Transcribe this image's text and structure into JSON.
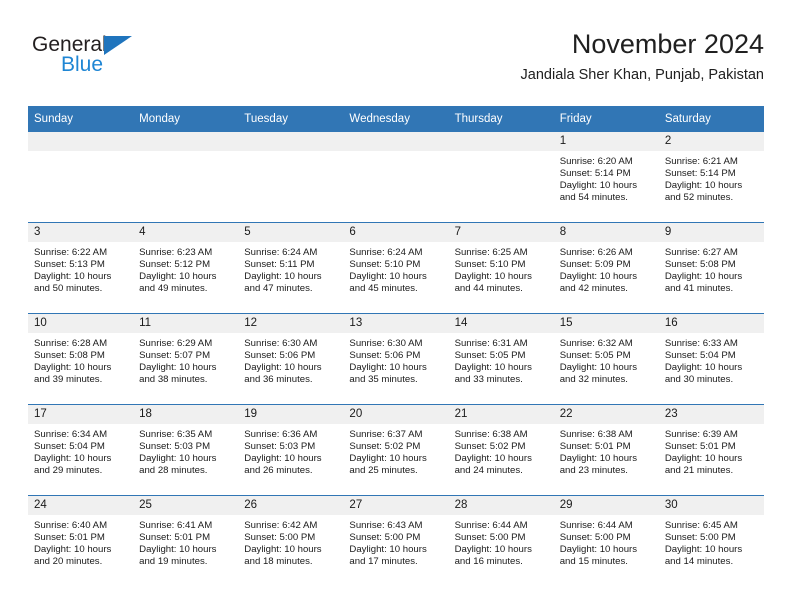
{
  "logo": {
    "word_one": "General",
    "word_two": "Blue",
    "triangle_icon": "triangle-icon",
    "accent_dark": "#231f20",
    "accent_blue": "#1f86d4"
  },
  "header": {
    "month_title": "November 2024",
    "location": "Jandiala Sher Khan, Punjab, Pakistan"
  },
  "theme": {
    "header_blue": "#3176b5",
    "daynum_gray": "#f0f0f0",
    "text": "#1a1a1a"
  },
  "weekday_headers": [
    "Sunday",
    "Monday",
    "Tuesday",
    "Wednesday",
    "Thursday",
    "Friday",
    "Saturday"
  ],
  "weeks": [
    [
      {
        "day": "",
        "sunrise": "",
        "sunset": "",
        "daylight_1": "",
        "daylight_2": ""
      },
      {
        "day": "",
        "sunrise": "",
        "sunset": "",
        "daylight_1": "",
        "daylight_2": ""
      },
      {
        "day": "",
        "sunrise": "",
        "sunset": "",
        "daylight_1": "",
        "daylight_2": ""
      },
      {
        "day": "",
        "sunrise": "",
        "sunset": "",
        "daylight_1": "",
        "daylight_2": ""
      },
      {
        "day": "",
        "sunrise": "",
        "sunset": "",
        "daylight_1": "",
        "daylight_2": ""
      },
      {
        "day": "1",
        "sunrise": "Sunrise: 6:20 AM",
        "sunset": "Sunset: 5:14 PM",
        "daylight_1": "Daylight: 10 hours",
        "daylight_2": "and 54 minutes."
      },
      {
        "day": "2",
        "sunrise": "Sunrise: 6:21 AM",
        "sunset": "Sunset: 5:14 PM",
        "daylight_1": "Daylight: 10 hours",
        "daylight_2": "and 52 minutes."
      }
    ],
    [
      {
        "day": "3",
        "sunrise": "Sunrise: 6:22 AM",
        "sunset": "Sunset: 5:13 PM",
        "daylight_1": "Daylight: 10 hours",
        "daylight_2": "and 50 minutes."
      },
      {
        "day": "4",
        "sunrise": "Sunrise: 6:23 AM",
        "sunset": "Sunset: 5:12 PM",
        "daylight_1": "Daylight: 10 hours",
        "daylight_2": "and 49 minutes."
      },
      {
        "day": "5",
        "sunrise": "Sunrise: 6:24 AM",
        "sunset": "Sunset: 5:11 PM",
        "daylight_1": "Daylight: 10 hours",
        "daylight_2": "and 47 minutes."
      },
      {
        "day": "6",
        "sunrise": "Sunrise: 6:24 AM",
        "sunset": "Sunset: 5:10 PM",
        "daylight_1": "Daylight: 10 hours",
        "daylight_2": "and 45 minutes."
      },
      {
        "day": "7",
        "sunrise": "Sunrise: 6:25 AM",
        "sunset": "Sunset: 5:10 PM",
        "daylight_1": "Daylight: 10 hours",
        "daylight_2": "and 44 minutes."
      },
      {
        "day": "8",
        "sunrise": "Sunrise: 6:26 AM",
        "sunset": "Sunset: 5:09 PM",
        "daylight_1": "Daylight: 10 hours",
        "daylight_2": "and 42 minutes."
      },
      {
        "day": "9",
        "sunrise": "Sunrise: 6:27 AM",
        "sunset": "Sunset: 5:08 PM",
        "daylight_1": "Daylight: 10 hours",
        "daylight_2": "and 41 minutes."
      }
    ],
    [
      {
        "day": "10",
        "sunrise": "Sunrise: 6:28 AM",
        "sunset": "Sunset: 5:08 PM",
        "daylight_1": "Daylight: 10 hours",
        "daylight_2": "and 39 minutes."
      },
      {
        "day": "11",
        "sunrise": "Sunrise: 6:29 AM",
        "sunset": "Sunset: 5:07 PM",
        "daylight_1": "Daylight: 10 hours",
        "daylight_2": "and 38 minutes."
      },
      {
        "day": "12",
        "sunrise": "Sunrise: 6:30 AM",
        "sunset": "Sunset: 5:06 PM",
        "daylight_1": "Daylight: 10 hours",
        "daylight_2": "and 36 minutes."
      },
      {
        "day": "13",
        "sunrise": "Sunrise: 6:30 AM",
        "sunset": "Sunset: 5:06 PM",
        "daylight_1": "Daylight: 10 hours",
        "daylight_2": "and 35 minutes."
      },
      {
        "day": "14",
        "sunrise": "Sunrise: 6:31 AM",
        "sunset": "Sunset: 5:05 PM",
        "daylight_1": "Daylight: 10 hours",
        "daylight_2": "and 33 minutes."
      },
      {
        "day": "15",
        "sunrise": "Sunrise: 6:32 AM",
        "sunset": "Sunset: 5:05 PM",
        "daylight_1": "Daylight: 10 hours",
        "daylight_2": "and 32 minutes."
      },
      {
        "day": "16",
        "sunrise": "Sunrise: 6:33 AM",
        "sunset": "Sunset: 5:04 PM",
        "daylight_1": "Daylight: 10 hours",
        "daylight_2": "and 30 minutes."
      }
    ],
    [
      {
        "day": "17",
        "sunrise": "Sunrise: 6:34 AM",
        "sunset": "Sunset: 5:04 PM",
        "daylight_1": "Daylight: 10 hours",
        "daylight_2": "and 29 minutes."
      },
      {
        "day": "18",
        "sunrise": "Sunrise: 6:35 AM",
        "sunset": "Sunset: 5:03 PM",
        "daylight_1": "Daylight: 10 hours",
        "daylight_2": "and 28 minutes."
      },
      {
        "day": "19",
        "sunrise": "Sunrise: 6:36 AM",
        "sunset": "Sunset: 5:03 PM",
        "daylight_1": "Daylight: 10 hours",
        "daylight_2": "and 26 minutes."
      },
      {
        "day": "20",
        "sunrise": "Sunrise: 6:37 AM",
        "sunset": "Sunset: 5:02 PM",
        "daylight_1": "Daylight: 10 hours",
        "daylight_2": "and 25 minutes."
      },
      {
        "day": "21",
        "sunrise": "Sunrise: 6:38 AM",
        "sunset": "Sunset: 5:02 PM",
        "daylight_1": "Daylight: 10 hours",
        "daylight_2": "and 24 minutes."
      },
      {
        "day": "22",
        "sunrise": "Sunrise: 6:38 AM",
        "sunset": "Sunset: 5:01 PM",
        "daylight_1": "Daylight: 10 hours",
        "daylight_2": "and 23 minutes."
      },
      {
        "day": "23",
        "sunrise": "Sunrise: 6:39 AM",
        "sunset": "Sunset: 5:01 PM",
        "daylight_1": "Daylight: 10 hours",
        "daylight_2": "and 21 minutes."
      }
    ],
    [
      {
        "day": "24",
        "sunrise": "Sunrise: 6:40 AM",
        "sunset": "Sunset: 5:01 PM",
        "daylight_1": "Daylight: 10 hours",
        "daylight_2": "and 20 minutes."
      },
      {
        "day": "25",
        "sunrise": "Sunrise: 6:41 AM",
        "sunset": "Sunset: 5:01 PM",
        "daylight_1": "Daylight: 10 hours",
        "daylight_2": "and 19 minutes."
      },
      {
        "day": "26",
        "sunrise": "Sunrise: 6:42 AM",
        "sunset": "Sunset: 5:00 PM",
        "daylight_1": "Daylight: 10 hours",
        "daylight_2": "and 18 minutes."
      },
      {
        "day": "27",
        "sunrise": "Sunrise: 6:43 AM",
        "sunset": "Sunset: 5:00 PM",
        "daylight_1": "Daylight: 10 hours",
        "daylight_2": "and 17 minutes."
      },
      {
        "day": "28",
        "sunrise": "Sunrise: 6:44 AM",
        "sunset": "Sunset: 5:00 PM",
        "daylight_1": "Daylight: 10 hours",
        "daylight_2": "and 16 minutes."
      },
      {
        "day": "29",
        "sunrise": "Sunrise: 6:44 AM",
        "sunset": "Sunset: 5:00 PM",
        "daylight_1": "Daylight: 10 hours",
        "daylight_2": "and 15 minutes."
      },
      {
        "day": "30",
        "sunrise": "Sunrise: 6:45 AM",
        "sunset": "Sunset: 5:00 PM",
        "daylight_1": "Daylight: 10 hours",
        "daylight_2": "and 14 minutes."
      }
    ]
  ]
}
